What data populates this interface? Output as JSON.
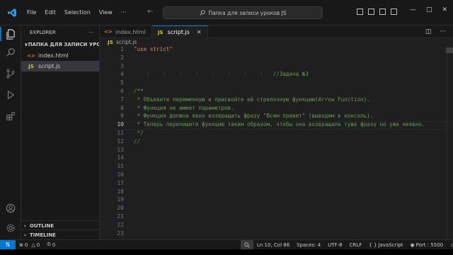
{
  "menu": [
    "File",
    "Edit",
    "Selection",
    "View",
    "···"
  ],
  "search": {
    "text": "Папка для записи уроков JS"
  },
  "sidebar": {
    "title": "EXPLORER",
    "folder": "ПАПКА ДЛЯ ЗАПИСИ УРО...",
    "files": [
      {
        "name": "index.html",
        "icon": "html-file-icon"
      },
      {
        "name": "script.js",
        "icon": "js-file-icon"
      }
    ],
    "outline": "OUTLINE",
    "timeline": "TIMELINE"
  },
  "tabs": [
    {
      "name": "index.html"
    },
    {
      "name": "script.js"
    }
  ],
  "breadcrumb": {
    "file": "script.js"
  },
  "editor": {
    "current_line": 10,
    "line_numbers": [
      "1",
      "2",
      "3",
      "4",
      "5",
      "6",
      "7",
      "8",
      "9",
      "10",
      "11",
      "12",
      "13",
      "14",
      "15",
      "16",
      "17",
      "18",
      "19",
      "20",
      "21",
      "22",
      "23"
    ],
    "lines": [
      "\"use strict\"",
      "",
      "",
      "//Задача №3",
      "",
      "/**",
      " * Объявите переменную и присвойте ей стрелочную функцию(Arrow Function).",
      " * Функция не имеет параметров.",
      " * Функция должна явно возвращать фразу \"Всем привет\" (выводим в консоль).",
      " * Теперь перепишите функцию таким образом, чтобы она возвращала туже фразу но уже неявно.",
      " */",
      "//"
    ]
  },
  "status": {
    "errors": "0",
    "warnings": "0",
    "ports": "0",
    "position": "Ln 10, Col 86",
    "spaces": "Spaces: 4",
    "encoding": "UTF-8",
    "eol": "CRLF",
    "language": "JavaScript",
    "port": "Port : 5500"
  },
  "colors": {
    "accent": "#0078d4",
    "string": "#ce9178",
    "comment": "#6a9955"
  }
}
